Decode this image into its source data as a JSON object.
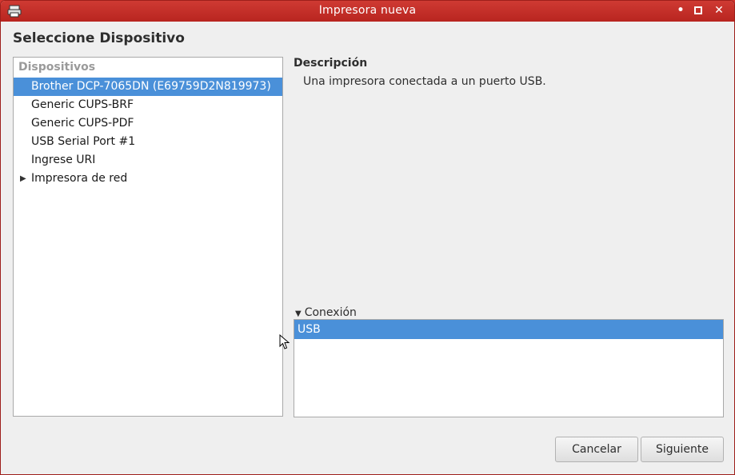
{
  "window": {
    "title": "Impresora nueva",
    "controls": {
      "minimize": "•",
      "maximize": "▫",
      "close": "✕"
    }
  },
  "heading": "Seleccione Dispositivo",
  "devices": {
    "header": "Dispositivos",
    "items": [
      {
        "label": "Brother DCP-7065DN (E69759D2N819973)",
        "selected": true
      },
      {
        "label": "Generic CUPS-BRF",
        "selected": false
      },
      {
        "label": "Generic CUPS-PDF",
        "selected": false
      },
      {
        "label": "USB Serial Port #1",
        "selected": false
      },
      {
        "label": "Ingrese URI",
        "selected": false
      },
      {
        "label": "Impresora de red",
        "selected": false,
        "expandable": true,
        "expanded": false
      }
    ]
  },
  "description": {
    "label": "Descripción",
    "text": "Una impresora conectada a un puerto USB."
  },
  "connection": {
    "label": "Conexión",
    "expanded": true,
    "items": [
      {
        "label": "USB",
        "selected": true
      }
    ]
  },
  "buttons": {
    "cancel": "Cancelar",
    "next": "Siguiente"
  },
  "colors": {
    "titlebar": "#c4302a",
    "selection": "#4a90d9",
    "window_bg": "#efefef"
  }
}
